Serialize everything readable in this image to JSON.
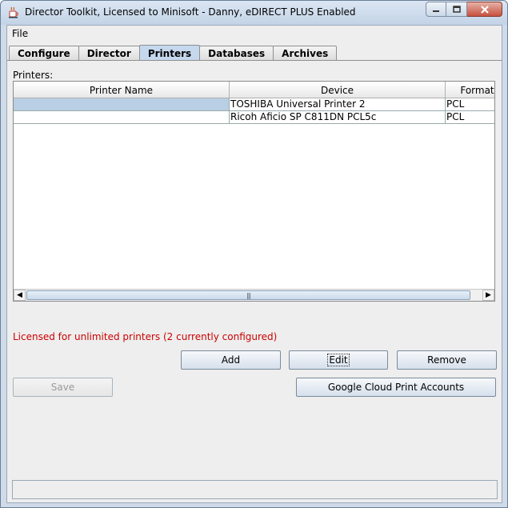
{
  "window": {
    "title": "Director Toolkit, Licensed to Minisoft - Danny, eDIRECT PLUS Enabled",
    "icon": "java-cup-icon"
  },
  "menu": {
    "file": "File"
  },
  "tabs": [
    {
      "label": "Configure",
      "active": false
    },
    {
      "label": "Director",
      "active": false
    },
    {
      "label": "Printers",
      "active": true
    },
    {
      "label": "Databases",
      "active": false
    },
    {
      "label": "Archives",
      "active": false
    }
  ],
  "printers": {
    "label": "Printers:",
    "columns": [
      "Printer Name",
      "Device",
      "Format"
    ],
    "rows": [
      {
        "name": "",
        "device": "TOSHIBA Universal Printer 2",
        "format": "PCL",
        "selected": true
      },
      {
        "name": "",
        "device": "Ricoh Aficio SP C811DN PCL5c",
        "format": "PCL",
        "selected": false
      }
    ],
    "scrollbar_thumb": "|||"
  },
  "license_text": "Licensed for unlimited printers (2 currently configured)",
  "buttons": {
    "add": "Add",
    "edit": "Edit",
    "remove": "Remove",
    "save": "Save",
    "google": "Google Cloud Print Accounts"
  },
  "colors": {
    "license": "#cc0000",
    "selected_row": "#b8cfe5",
    "active_tab": "#c5d8ee"
  }
}
